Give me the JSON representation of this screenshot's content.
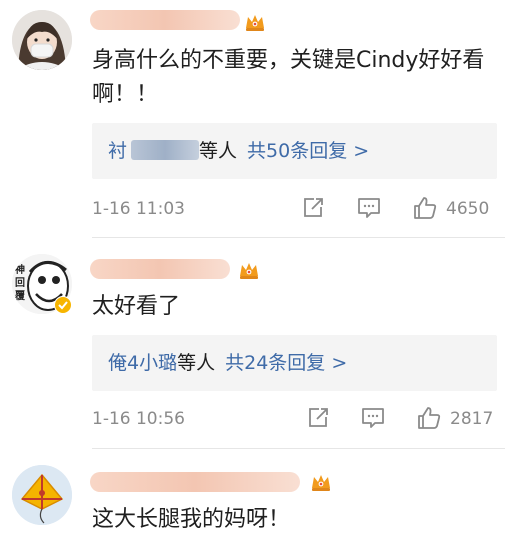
{
  "comments": [
    {
      "text": "身高什么的不重要，关键是Cindy好好看啊！！",
      "reply_prefix": "衬",
      "reply_etc": "等人",
      "reply_count": "共50条回复 >",
      "time": "1-16 11:03",
      "likes": "4650"
    },
    {
      "text": "太好看了",
      "reply_prefix": "俺4小璐",
      "reply_etc": "等人",
      "reply_count": "共24条回复 >",
      "time": "1-16 10:56",
      "likes": "2817"
    },
    {
      "text": "这大长腿我的妈呀！"
    }
  ],
  "avatar2_label": "神回覆",
  "colors": {
    "link_blue": "#3f6ba8",
    "meta_gray": "#8a8a8a",
    "reply_bg": "#f4f4f4",
    "crown_orange": "#f29b1d"
  }
}
